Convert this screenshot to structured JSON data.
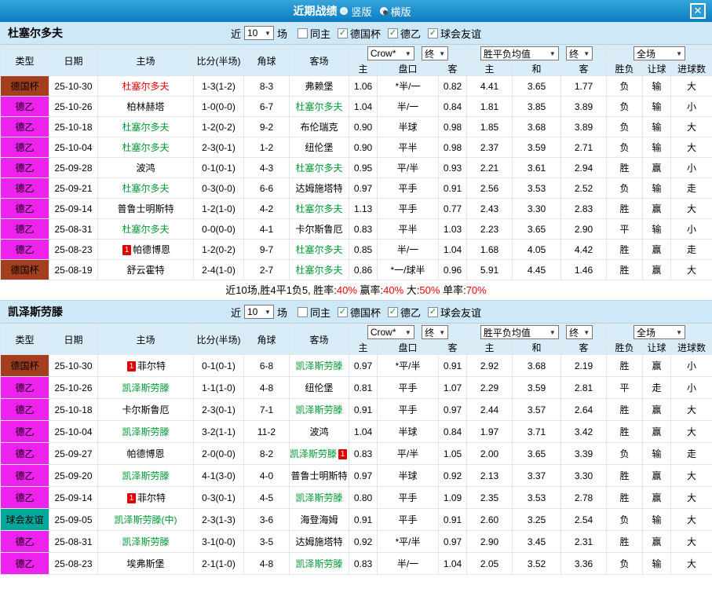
{
  "titlebar": {
    "title": "近期战绩",
    "radio_vertical": "竖版",
    "radio_horizontal": "横版",
    "close_icon": "✕"
  },
  "controls": {
    "near_label": "近",
    "games_value": "10",
    "games_suffix": "场",
    "check_glyph": "✓",
    "checkboxes": [
      {
        "label": "同主",
        "checked": false
      },
      {
        "label": "德国杯",
        "checked": true
      },
      {
        "label": "德乙",
        "checked": true
      },
      {
        "label": "球会友谊",
        "checked": true
      }
    ]
  },
  "table_header": {
    "cols": [
      "类型",
      "日期",
      "主场",
      "比分(半场)",
      "角球",
      "客场"
    ],
    "crow_select": "Crow*",
    "end_select1": "终",
    "wdl_select": "胜平负均值",
    "end_select2": "终",
    "fullmatch_select": "全场",
    "sub_cols_asia": [
      "主",
      "盘口",
      "客"
    ],
    "sub_cols_euro": [
      "主",
      "和",
      "客"
    ],
    "sub_cols_result": [
      "胜负",
      "让球",
      "进球数"
    ]
  },
  "colors": {
    "titlebar_blue": "#0d7cc0",
    "section_bg": "#cfe8f7",
    "table_header_bg": "#d9edf8",
    "cup_badge": "#a33e1f",
    "league2_badge": "#ee22ee",
    "friendly_badge": "#00a79b",
    "win_red": "#f00000",
    "lose_green": "#009933",
    "draw_blue": "#0000ee"
  },
  "sections": [
    {
      "team": "杜塞尔多夫",
      "rows": [
        {
          "lg": "德国杯",
          "lgc": "cup",
          "date": "25-10-30",
          "home": "杜塞尔多夫",
          "hc": "red",
          "score": "1-3(1-2)",
          "cor": "8-3",
          "away": "弗赖堡",
          "ac": "",
          "o1": "1.06",
          "hcp": "*半/一",
          "hcpc": "red",
          "o2": "0.82",
          "e1": "4.41",
          "e2": "3.65",
          "e3": "1.77",
          "r1": "负",
          "r1c": "red",
          "r2": "输",
          "r2c": "green",
          "r3": "大",
          "r3c": "red"
        },
        {
          "lg": "德乙",
          "lgc": "l2",
          "date": "25-10-26",
          "home": "柏林赫塔",
          "hc": "",
          "score": "1-0(0-0)",
          "cor": "6-7",
          "away": "杜塞尔多夫",
          "ac": "green",
          "o1": "1.04",
          "hcp": "半/一",
          "hcpc": "",
          "o2": "0.84",
          "e1": "1.81",
          "e2": "3.85",
          "e3": "3.89",
          "r1": "负",
          "r1c": "red",
          "r2": "输",
          "r2c": "green",
          "r3": "小",
          "r3c": "green"
        },
        {
          "lg": "德乙",
          "lgc": "l2",
          "date": "25-10-18",
          "home": "杜塞尔多夫",
          "hc": "green",
          "score": "1-2(0-2)",
          "cor": "9-2",
          "away": "布伦瑞克",
          "ac": "",
          "o1": "0.90",
          "hcp": "半球",
          "hcpc": "red",
          "o2": "0.98",
          "e1": "1.85",
          "e2": "3.68",
          "e3": "3.89",
          "r1": "负",
          "r1c": "red",
          "r2": "输",
          "r2c": "green",
          "r3": "大",
          "r3c": "red"
        },
        {
          "lg": "德乙",
          "lgc": "l2",
          "date": "25-10-04",
          "home": "杜塞尔多夫",
          "hc": "green",
          "score": "2-3(0-1)",
          "cor": "1-2",
          "away": "纽伦堡",
          "ac": "",
          "o1": "0.90",
          "hcp": "平半",
          "hcpc": "",
          "o2": "0.98",
          "e1": "2.37",
          "e2": "3.59",
          "e3": "2.71",
          "r1": "负",
          "r1c": "red",
          "r2": "输",
          "r2c": "green",
          "r3": "大",
          "r3c": "red"
        },
        {
          "lg": "德乙",
          "lgc": "l2",
          "date": "25-09-28",
          "home": "波鸿",
          "hc": "",
          "score": "0-1(0-1)",
          "cor": "4-3",
          "away": "杜塞尔多夫",
          "ac": "green",
          "o1": "0.95",
          "hcp": "平/半",
          "hcpc": "red",
          "o2": "0.93",
          "e1": "2.21",
          "e2": "3.61",
          "e3": "2.94",
          "r1": "胜",
          "r1c": "red",
          "r2": "赢",
          "r2c": "red",
          "r3": "小",
          "r3c": "green"
        },
        {
          "lg": "德乙",
          "lgc": "l2",
          "date": "25-09-21",
          "home": "杜塞尔多夫",
          "hc": "green",
          "score": "0-3(0-0)",
          "cor": "6-6",
          "away": "达姆施塔特",
          "ac": "",
          "o1": "0.97",
          "hcp": "平手",
          "hcpc": "",
          "o2": "0.91",
          "e1": "2.56",
          "e2": "3.53",
          "e3": "2.52",
          "r1": "负",
          "r1c": "red",
          "r2": "输",
          "r2c": "green",
          "r3": "走",
          "r3c": "blue"
        },
        {
          "lg": "德乙",
          "lgc": "l2",
          "date": "25-09-14",
          "home": "普鲁士明斯特",
          "hc": "",
          "score": "1-2(1-0)",
          "cor": "4-2",
          "away": "杜塞尔多夫",
          "ac": "green",
          "o1": "1.13",
          "hcp": "平手",
          "hcpc": "",
          "o2": "0.77",
          "e1": "2.43",
          "e2": "3.30",
          "e3": "2.83",
          "r1": "胜",
          "r1c": "red",
          "r2": "赢",
          "r2c": "red",
          "r3": "大",
          "r3c": "red"
        },
        {
          "lg": "德乙",
          "lgc": "l2",
          "date": "25-08-31",
          "home": "杜塞尔多夫",
          "hc": "green",
          "score": "0-0(0-0)",
          "cor": "4-1",
          "away": "卡尔斯鲁厄",
          "ac": "",
          "o1": "0.83",
          "hcp": "平半",
          "hcpc": "red",
          "o2": "1.03",
          "e1": "2.23",
          "e2": "3.65",
          "e3": "2.90",
          "r1": "平",
          "r1c": "blue",
          "r2": "输",
          "r2c": "green",
          "r3": "小",
          "r3c": "green"
        },
        {
          "lg": "德乙",
          "lgc": "l2",
          "date": "25-08-23",
          "hb": "1",
          "home": "帕德博恩",
          "hc": "",
          "score": "1-2(0-2)",
          "cor": "9-7",
          "away": "杜塞尔多夫",
          "ac": "green",
          "o1": "0.85",
          "hcp": "半/一",
          "hcpc": "red",
          "o2": "1.04",
          "e1": "1.68",
          "e2": "4.05",
          "e3": "4.42",
          "r1": "胜",
          "r1c": "red",
          "r2": "赢",
          "r2c": "red",
          "r3": "走",
          "r3c": "blue"
        },
        {
          "lg": "德国杯",
          "lgc": "cup",
          "date": "25-08-19",
          "home": "舒云霍特",
          "hc": "",
          "score": "2-4(1-0)",
          "cor": "2-7",
          "away": "杜塞尔多夫",
          "ac": "green",
          "o1": "0.86",
          "hcp": "*一/球半",
          "hcpc": "red",
          "o2": "0.96",
          "e1": "5.91",
          "e2": "4.45",
          "e3": "1.46",
          "r1": "胜",
          "r1c": "red",
          "r2": "赢",
          "r2c": "red",
          "r3": "大",
          "r3c": "red"
        }
      ],
      "summary_parts": [
        {
          "t": "近10场,胜4平1负5, 胜率:",
          "c": ""
        },
        {
          "t": "40%",
          "c": "red"
        },
        {
          "t": " 赢率:",
          "c": ""
        },
        {
          "t": "40%",
          "c": "red"
        },
        {
          "t": " 大:",
          "c": ""
        },
        {
          "t": "50%",
          "c": "red"
        },
        {
          "t": " 单率:",
          "c": ""
        },
        {
          "t": "70%",
          "c": "red"
        }
      ]
    },
    {
      "team": "凯泽斯劳滕",
      "rows": [
        {
          "lg": "德国杯",
          "lgc": "cup",
          "date": "25-10-30",
          "hb": "1",
          "home": "菲尔特",
          "hc": "",
          "score": "0-1(0-1)",
          "cor": "6-8",
          "away": "凯泽斯劳滕",
          "ac": "green",
          "o1": "0.97",
          "hcp": "*平/半",
          "hcpc": "red",
          "o2": "0.91",
          "e1": "2.92",
          "e2": "3.68",
          "e3": "2.19",
          "r1": "胜",
          "r1c": "red",
          "r2": "赢",
          "r2c": "red",
          "r3": "小",
          "r3c": "green"
        },
        {
          "lg": "德乙",
          "lgc": "l2",
          "date": "25-10-26",
          "home": "凯泽斯劳滕",
          "hc": "green",
          "score": "1-1(1-0)",
          "cor": "4-8",
          "away": "纽伦堡",
          "ac": "",
          "o1": "0.81",
          "hcp": "平手",
          "hcpc": "",
          "o2": "1.07",
          "e1": "2.29",
          "e2": "3.59",
          "e3": "2.81",
          "r1": "平",
          "r1c": "blue",
          "r2": "走",
          "r2c": "blue",
          "r3": "小",
          "r3c": "green"
        },
        {
          "lg": "德乙",
          "lgc": "l2",
          "date": "25-10-18",
          "home": "卡尔斯鲁厄",
          "hc": "",
          "score": "2-3(0-1)",
          "cor": "7-1",
          "away": "凯泽斯劳滕",
          "ac": "green",
          "o1": "0.91",
          "hcp": "平手",
          "hcpc": "",
          "o2": "0.97",
          "e1": "2.44",
          "e2": "3.57",
          "e3": "2.64",
          "r1": "胜",
          "r1c": "red",
          "r2": "赢",
          "r2c": "red",
          "r3": "大",
          "r3c": "red"
        },
        {
          "lg": "德乙",
          "lgc": "l2",
          "date": "25-10-04",
          "home": "凯泽斯劳滕",
          "hc": "green",
          "score": "3-2(1-1)",
          "cor": "11-2",
          "away": "波鸿",
          "ac": "",
          "o1": "1.04",
          "hcp": "半球",
          "hcpc": "",
          "o2": "0.84",
          "e1": "1.97",
          "e2": "3.71",
          "e3": "3.42",
          "r1": "胜",
          "r1c": "red",
          "r2": "赢",
          "r2c": "red",
          "r3": "大",
          "r3c": "red"
        },
        {
          "lg": "德乙",
          "lgc": "l2",
          "date": "25-09-27",
          "home": "帕德博恩",
          "hc": "",
          "score": "2-0(0-0)",
          "cor": "8-2",
          "away": "凯泽斯劳滕",
          "ac": "green",
          "ab": "1",
          "o1": "0.83",
          "hcp": "平/半",
          "hcpc": "",
          "o2": "1.05",
          "e1": "2.00",
          "e2": "3.65",
          "e3": "3.39",
          "r1": "负",
          "r1c": "red",
          "r2": "输",
          "r2c": "green",
          "r3": "走",
          "r3c": "blue"
        },
        {
          "lg": "德乙",
          "lgc": "l2",
          "date": "25-09-20",
          "home": "凯泽斯劳滕",
          "hc": "green",
          "score": "4-1(3-0)",
          "cor": "4-0",
          "away": "普鲁士明斯特",
          "ac": "",
          "o1": "0.97",
          "hcp": "半球",
          "hcpc": "",
          "o2": "0.92",
          "e1": "2.13",
          "e2": "3.37",
          "e3": "3.30",
          "r1": "胜",
          "r1c": "red",
          "r2": "赢",
          "r2c": "red",
          "r3": "大",
          "r3c": "red"
        },
        {
          "lg": "德乙",
          "lgc": "l2",
          "date": "25-09-14",
          "hb": "1",
          "home": "菲尔特",
          "hc": "",
          "score": "0-3(0-1)",
          "cor": "4-5",
          "away": "凯泽斯劳滕",
          "ac": "green",
          "o1": "0.80",
          "hcp": "平手",
          "hcpc": "",
          "o2": "1.09",
          "e1": "2.35",
          "e2": "3.53",
          "e3": "2.78",
          "r1": "胜",
          "r1c": "red",
          "r2": "赢",
          "r2c": "red",
          "r3": "大",
          "r3c": "red"
        },
        {
          "lg": "球会友谊",
          "lgc": "fr",
          "date": "25-09-05",
          "home": "凯泽斯劳滕(中)",
          "hc": "green",
          "score": "2-3(1-3)",
          "cor": "3-6",
          "away": "海登海姆",
          "ac": "",
          "o1": "0.91",
          "hcp": "平手",
          "hcpc": "",
          "o2": "0.91",
          "e1": "2.60",
          "e2": "3.25",
          "e3": "2.54",
          "r1": "负",
          "r1c": "red",
          "r2": "输",
          "r2c": "green",
          "r3": "大",
          "r3c": "red"
        },
        {
          "lg": "德乙",
          "lgc": "l2",
          "date": "25-08-31",
          "home": "凯泽斯劳滕",
          "hc": "green",
          "score": "3-1(0-0)",
          "cor": "3-5",
          "away": "达姆施塔特",
          "ac": "",
          "o1": "0.92",
          "hcp": "*平/半",
          "hcpc": "red",
          "o2": "0.97",
          "e1": "2.90",
          "e2": "3.45",
          "e3": "2.31",
          "r1": "胜",
          "r1c": "red",
          "r2": "赢",
          "r2c": "red",
          "r3": "大",
          "r3c": "red"
        },
        {
          "lg": "德乙",
          "lgc": "l2",
          "date": "25-08-23",
          "home": "埃弗斯堡",
          "hc": "",
          "score": "2-1(1-0)",
          "cor": "4-8",
          "away": "凯泽斯劳滕",
          "ac": "green",
          "o1": "0.83",
          "hcp": "半/一",
          "hcpc": "",
          "o2": "1.04",
          "e1": "2.05",
          "e2": "3.52",
          "e3": "3.36",
          "r1": "负",
          "r1c": "red",
          "r2": "输",
          "r2c": "green",
          "r3": "大",
          "r3c": "red"
        }
      ]
    }
  ]
}
